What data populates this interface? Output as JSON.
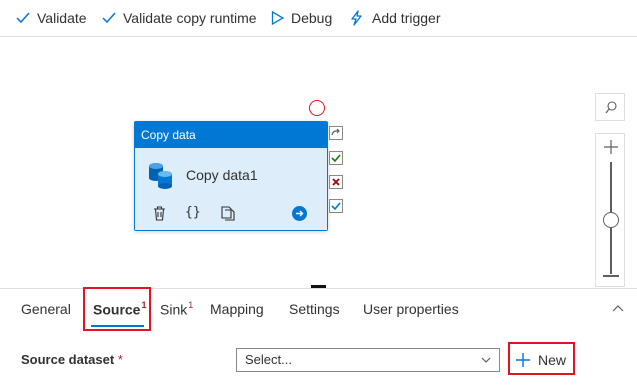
{
  "toolbar": {
    "validate_label": "Validate",
    "validate_copy_runtime_label": "Validate copy runtime",
    "debug_label": "Debug",
    "add_trigger_label": "Add trigger"
  },
  "activity": {
    "type_label": "Copy data",
    "name": "Copy data1"
  },
  "tabs": [
    {
      "label": "General",
      "badge": ""
    },
    {
      "label": "Source",
      "badge": "1"
    },
    {
      "label": "Sink",
      "badge": "1"
    },
    {
      "label": "Mapping",
      "badge": ""
    },
    {
      "label": "Settings",
      "badge": ""
    },
    {
      "label": "User properties",
      "badge": ""
    }
  ],
  "source": {
    "dataset_label": "Source dataset",
    "required_marker": "*",
    "select_placeholder": "Select...",
    "new_label": "New"
  },
  "colors": {
    "accent": "#0078d4",
    "highlight": "#e81123",
    "success": "#107c10",
    "error": "#a80000"
  }
}
